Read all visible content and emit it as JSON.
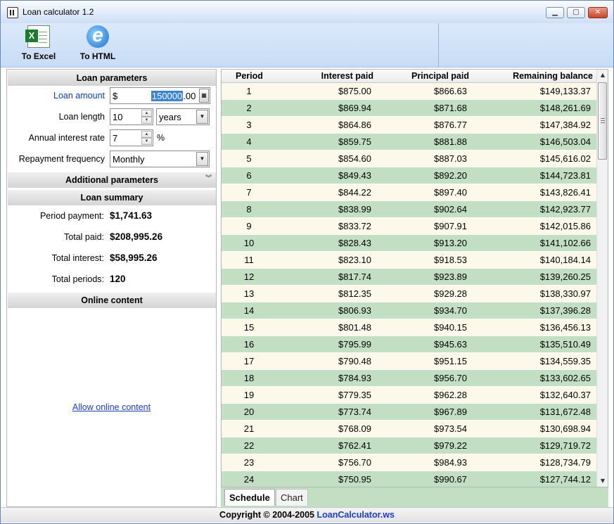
{
  "window": {
    "title": "Loan calculator 1.2",
    "minimize_label": "▁",
    "maximize_label": "▢",
    "close_label": "✕"
  },
  "toolbar": {
    "to_excel_label": "To Excel",
    "to_html_label": "To HTML"
  },
  "loan_parameters": {
    "header": "Loan parameters",
    "loan_amount": {
      "label": "Loan amount",
      "prefix": "$",
      "value": "150000",
      "suffix": ".00"
    },
    "loan_length": {
      "label": "Loan length",
      "value": "10",
      "unit": "years"
    },
    "interest_rate": {
      "label": "Annual interest rate",
      "value": "7",
      "unit": "%"
    },
    "repayment_frequency": {
      "label": "Repayment frequency",
      "value": "Monthly"
    }
  },
  "additional_parameters": {
    "header": "Additional parameters"
  },
  "loan_summary": {
    "header": "Loan summary",
    "items": [
      {
        "label": "Period payment:",
        "value": "$1,741.63"
      },
      {
        "label": "Total paid:",
        "value": "$208,995.26"
      },
      {
        "label": "Total interest:",
        "value": "$58,995.26"
      },
      {
        "label": "Total periods:",
        "value": "120"
      }
    ]
  },
  "online_content": {
    "header": "Online content",
    "link": "Allow online content"
  },
  "schedule": {
    "columns": [
      "Period",
      "Interest paid",
      "Principal paid",
      "Remaining balance"
    ],
    "rows": [
      [
        "1",
        "$875.00",
        "$866.63",
        "$149,133.37"
      ],
      [
        "2",
        "$869.94",
        "$871.68",
        "$148,261.69"
      ],
      [
        "3",
        "$864.86",
        "$876.77",
        "$147,384.92"
      ],
      [
        "4",
        "$859.75",
        "$881.88",
        "$146,503.04"
      ],
      [
        "5",
        "$854.60",
        "$887.03",
        "$145,616.02"
      ],
      [
        "6",
        "$849.43",
        "$892.20",
        "$144,723.81"
      ],
      [
        "7",
        "$844.22",
        "$897.40",
        "$143,826.41"
      ],
      [
        "8",
        "$838.99",
        "$902.64",
        "$142,923.77"
      ],
      [
        "9",
        "$833.72",
        "$907.91",
        "$142,015.86"
      ],
      [
        "10",
        "$828.43",
        "$913.20",
        "$141,102.66"
      ],
      [
        "11",
        "$823.10",
        "$918.53",
        "$140,184.14"
      ],
      [
        "12",
        "$817.74",
        "$923.89",
        "$139,260.25"
      ],
      [
        "13",
        "$812.35",
        "$929.28",
        "$138,330.97"
      ],
      [
        "14",
        "$806.93",
        "$934.70",
        "$137,396.28"
      ],
      [
        "15",
        "$801.48",
        "$940.15",
        "$136,456.13"
      ],
      [
        "16",
        "$795.99",
        "$945.63",
        "$135,510.49"
      ],
      [
        "17",
        "$790.48",
        "$951.15",
        "$134,559.35"
      ],
      [
        "18",
        "$784.93",
        "$956.70",
        "$133,602.65"
      ],
      [
        "19",
        "$779.35",
        "$962.28",
        "$132,640.37"
      ],
      [
        "20",
        "$773.74",
        "$967.89",
        "$131,672.48"
      ],
      [
        "21",
        "$768.09",
        "$973.54",
        "$130,698.94"
      ],
      [
        "22",
        "$762.41",
        "$979.22",
        "$129,719.72"
      ],
      [
        "23",
        "$756.70",
        "$984.93",
        "$128,734.79"
      ],
      [
        "24",
        "$750.95",
        "$990.67",
        "$127,744.12"
      ]
    ]
  },
  "tabs": {
    "schedule": "Schedule",
    "chart": "Chart"
  },
  "footer": {
    "copyright": "Copyright © 2004-2005 ",
    "link": "LoanCalculator.ws"
  },
  "colors": {
    "row_odd": "#fdf9ea",
    "row_even": "#c2dec3",
    "link_blue": "#1a3ccf",
    "selection": "#3a84d8"
  }
}
